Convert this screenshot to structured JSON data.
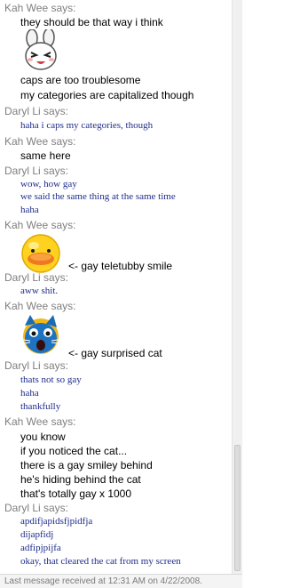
{
  "messages": [
    {
      "sender": "Kah Wee says:",
      "lines": [
        "they should be that way i think"
      ]
    },
    {
      "emoticon": "rabbit-face-icon",
      "lines": [
        "caps are too troublesome",
        "my categories are capitalized though"
      ]
    },
    {
      "sender": "Daryl Li says:",
      "lines": [
        "haha i caps my categories, though"
      ]
    },
    {
      "sender": "Kah Wee says:",
      "lines": [
        "same here"
      ]
    },
    {
      "sender": "Daryl Li says:",
      "lines": [
        "wow, how gay",
        "we said the same thing at the same time",
        "haha"
      ]
    },
    {
      "sender": "Kah Wee says:",
      "emoticon": "teletubby-sun-icon",
      "caption": "<- gay teletubby smile"
    },
    {
      "sender": "Daryl Li says:",
      "lines": [
        "aww shit."
      ]
    },
    {
      "sender": "Kah Wee says:",
      "emoticon": "surprised-cat-icon",
      "caption": "<- gay surprised cat"
    },
    {
      "sender": "Daryl Li says:",
      "lines": [
        "thats not so gay",
        "haha",
        "thankfully"
      ]
    },
    {
      "sender": "Kah Wee says:",
      "lines": [
        "you know",
        "if you noticed the cat...",
        "there is a gay smiley behind",
        "he's hiding behind the cat",
        "that's totally gay x 1000"
      ]
    },
    {
      "sender": "Daryl Li says:",
      "lines": [
        "apdifjapidsfjpidfja",
        "dijapfidj",
        "adfipjpijfa",
        "okay, that cleared the cat from my screen"
      ]
    }
  ],
  "status_bar": {
    "text": "Last message received at 12:31 AM on 4/22/2008."
  },
  "colors": {
    "sender": "#7f7f7f",
    "kah_wee_text": "#000000",
    "daryl_li_text": "#1f2c8c",
    "background": "#ffffff"
  }
}
